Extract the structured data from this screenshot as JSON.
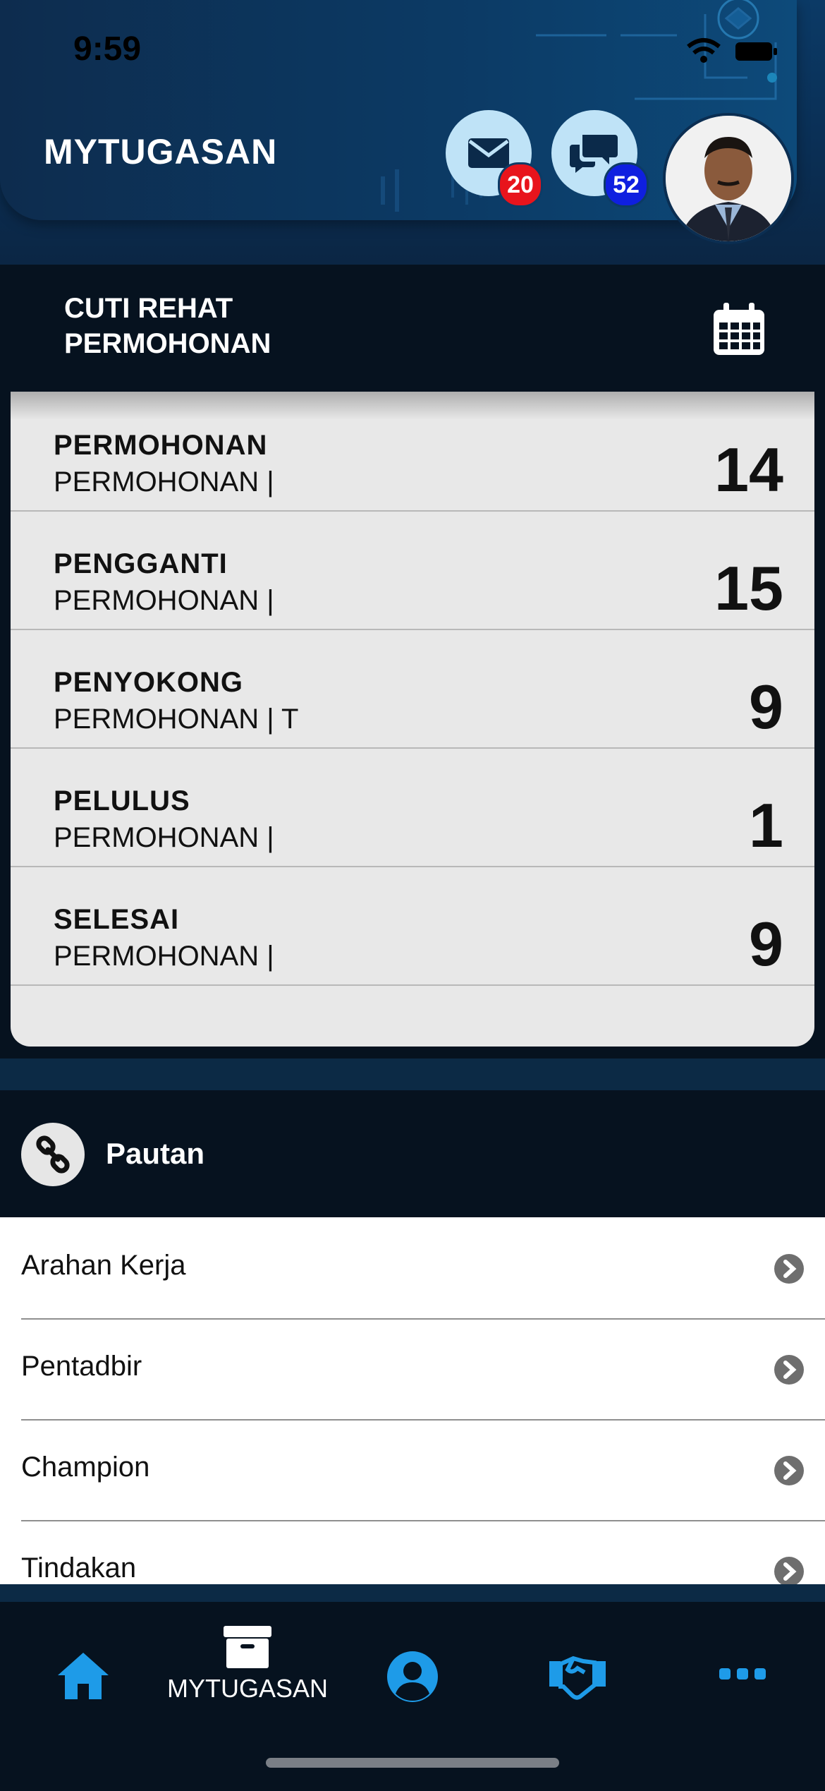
{
  "status": {
    "time": "9:59"
  },
  "header": {
    "title": "MYTUGASAN",
    "mail_badge": "20",
    "chat_badge": "52"
  },
  "section": {
    "title_line1": "CUTI REHAT",
    "title_line2": "PERMOHONAN"
  },
  "rows": [
    {
      "title": "PERMOHONAN",
      "subtitle": "PERMOHONAN |",
      "count": "14"
    },
    {
      "title": "PENGGANTI",
      "subtitle": "PERMOHONAN |",
      "count": "15"
    },
    {
      "title": "PENYOKONG",
      "subtitle": "PERMOHONAN | T",
      "count": "9"
    },
    {
      "title": "PELULUS",
      "subtitle": "PERMOHONAN |",
      "count": "1"
    },
    {
      "title": "SELESAI",
      "subtitle": "PERMOHONAN |",
      "count": "9"
    }
  ],
  "pautan": {
    "title": "Pautan",
    "items": [
      "Arahan Kerja",
      "Pentadbir",
      "Champion",
      "Tindakan"
    ]
  },
  "tabbar": {
    "active_label": "MYTUGASAN"
  },
  "colors": {
    "accent": "#1e9be8",
    "badge_red": "#e8141c",
    "badge_blue": "#0f1fe0",
    "dark_bg": "#06121f"
  }
}
